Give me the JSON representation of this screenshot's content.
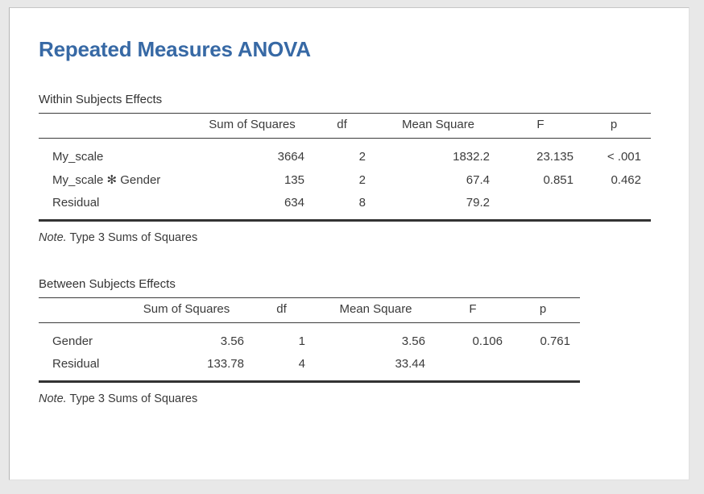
{
  "panel": {
    "title": "Repeated Measures ANOVA"
  },
  "tables": [
    {
      "id": "within",
      "caption": "Within Subjects Effects",
      "columns": [
        "",
        "Sum of Squares",
        "df",
        "Mean Square",
        "F",
        "p"
      ],
      "rows": [
        {
          "label": "My_scale",
          "ss": "3664",
          "df": "2",
          "ms": "1832.2",
          "f": "23.135",
          "p": "< .001"
        },
        {
          "label": "My_scale ✻ Gender",
          "ss": "135",
          "df": "2",
          "ms": "67.4",
          "f": "0.851",
          "p": "0.462"
        },
        {
          "label": "Residual",
          "ss": "634",
          "df": "8",
          "ms": "79.2",
          "f": "",
          "p": ""
        }
      ],
      "note_label": "Note.",
      "note_text": " Type 3 Sums of Squares"
    },
    {
      "id": "between",
      "caption": "Between Subjects Effects",
      "columns": [
        "",
        "Sum of Squares",
        "df",
        "Mean Square",
        "F",
        "p"
      ],
      "rows": [
        {
          "label": "Gender",
          "ss": "3.56",
          "df": "1",
          "ms": "3.56",
          "f": "0.106",
          "p": "0.761"
        },
        {
          "label": "Residual",
          "ss": "133.78",
          "df": "4",
          "ms": "33.44",
          "f": "",
          "p": ""
        }
      ],
      "note_label": "Note.",
      "note_text": " Type 3 Sums of Squares"
    }
  ],
  "colors": {
    "title_blue": "#3769a5",
    "text": "#3b3b3b",
    "rule": "#333333",
    "panel_background": "#ffffff",
    "app_background": "#e8e8e8"
  }
}
